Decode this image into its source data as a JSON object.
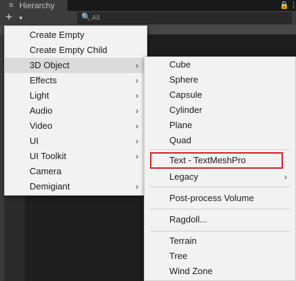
{
  "panel": {
    "tab_icon": "≡",
    "tab_title": "Hierarchy",
    "lock_icon": "🔒",
    "menu_icon": "⋮"
  },
  "toolbar": {
    "add_symbol": "+",
    "add_caret": "▾",
    "search_icon": "🔍",
    "search_placeholder": "All"
  },
  "menu_main": {
    "items": [
      {
        "label": "Create Empty",
        "submenu": false
      },
      {
        "label": "Create Empty Child",
        "submenu": false
      },
      {
        "label": "3D Object",
        "submenu": true,
        "active": true
      },
      {
        "label": "Effects",
        "submenu": true
      },
      {
        "label": "Light",
        "submenu": true
      },
      {
        "label": "Audio",
        "submenu": true
      },
      {
        "label": "Video",
        "submenu": true
      },
      {
        "label": "UI",
        "submenu": true
      },
      {
        "label": "UI Toolkit",
        "submenu": true
      },
      {
        "label": "Camera",
        "submenu": false
      },
      {
        "label": "Demigiant",
        "submenu": true
      }
    ],
    "arrow": "›"
  },
  "menu_3d": {
    "items": [
      {
        "label": "Cube"
      },
      {
        "label": "Sphere"
      },
      {
        "label": "Capsule"
      },
      {
        "label": "Cylinder"
      },
      {
        "label": "Plane"
      },
      {
        "label": "Quad"
      },
      {
        "label": "Text - TextMeshPro",
        "highlighted": true
      },
      {
        "label": "Legacy",
        "submenu": true
      },
      {
        "label": "Post-process Volume"
      },
      {
        "label": "Ragdoll..."
      },
      {
        "label": "Terrain"
      },
      {
        "label": "Tree"
      },
      {
        "label": "Wind Zone"
      }
    ],
    "arrow": "›"
  },
  "colors": {
    "menu_bg": "#f2f2f2",
    "highlight_border": "#d21f26",
    "active_item_bg": "#dadada"
  }
}
